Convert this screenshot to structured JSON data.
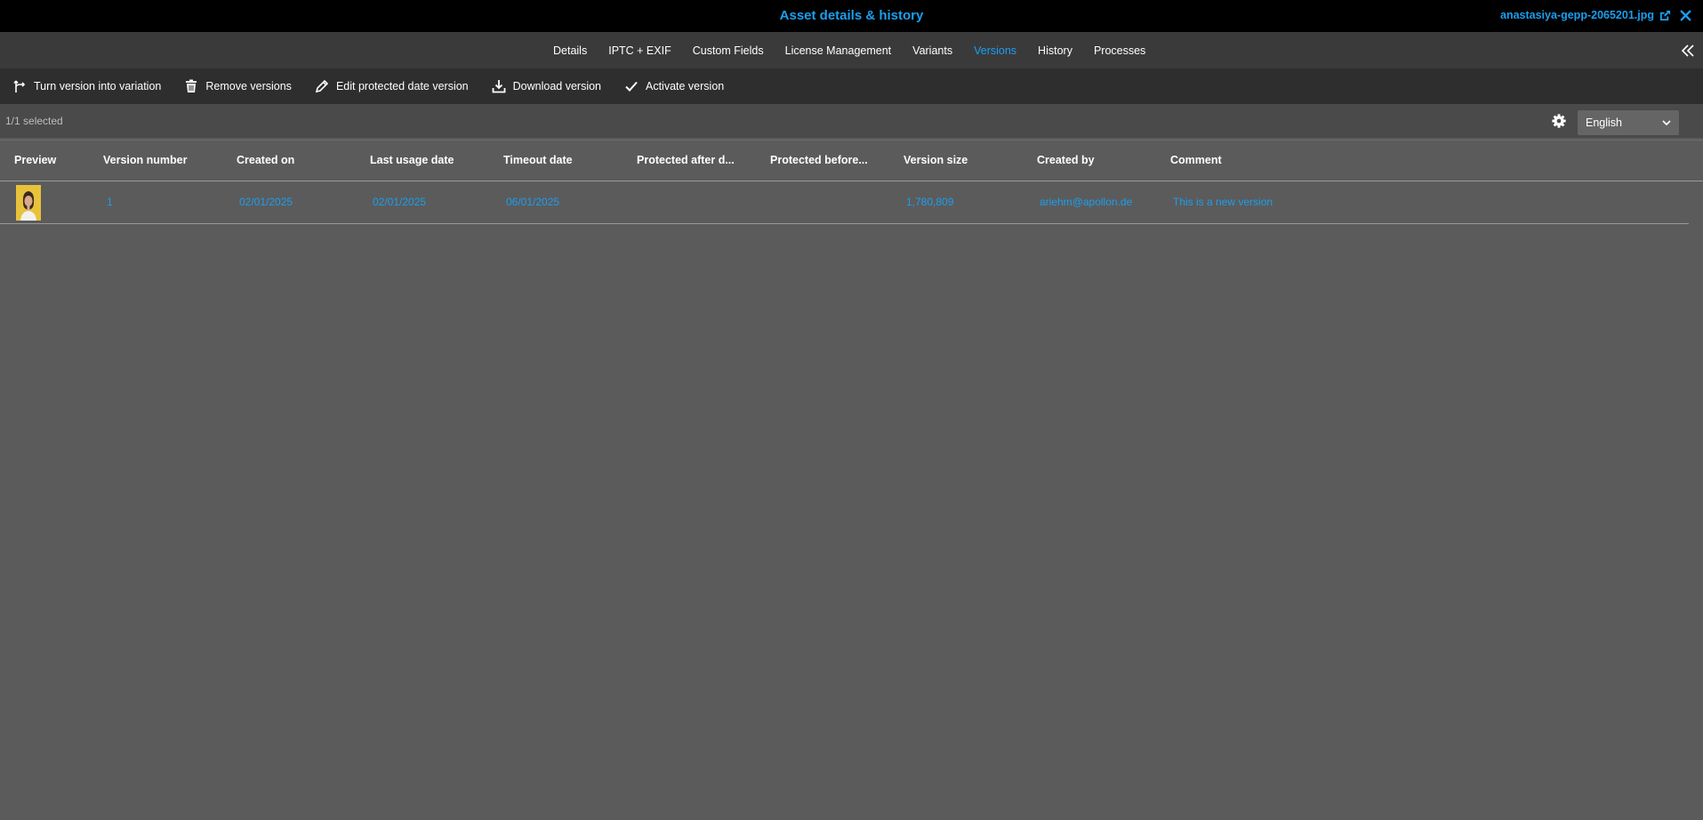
{
  "window": {
    "title": "Asset details & history",
    "filename": "anastasiya-gepp-2065201.jpg",
    "icons": [
      "external-link-icon",
      "close-icon"
    ]
  },
  "tabs": [
    {
      "label": "Details",
      "active": false
    },
    {
      "label": "IPTC + EXIF",
      "active": false
    },
    {
      "label": "Custom Fields",
      "active": false
    },
    {
      "label": "License Management",
      "active": false
    },
    {
      "label": "Variants",
      "active": false
    },
    {
      "label": "Versions",
      "active": true
    },
    {
      "label": "History",
      "active": false
    },
    {
      "label": "Processes",
      "active": false
    }
  ],
  "toolbar": {
    "actions": [
      {
        "label": "Turn version into variation",
        "icon": "branch-icon"
      },
      {
        "label": "Remove versions",
        "icon": "trash-icon"
      },
      {
        "label": "Edit protected date version",
        "icon": "pencil-icon"
      },
      {
        "label": "Download version",
        "icon": "download-icon"
      },
      {
        "label": "Activate version",
        "icon": "check-icon"
      }
    ]
  },
  "status": {
    "selected": "1/1 selected",
    "language": "English"
  },
  "table": {
    "columns": [
      "Preview",
      "Version number",
      "Created on",
      "Last usage date",
      "Timeout date",
      "Protected after d...",
      "Protected before...",
      "Version size",
      "Created by",
      "Comment"
    ],
    "rows": [
      {
        "version_number": "1",
        "created_on": "02/01/2025",
        "last_usage_date": "02/01/2025",
        "timeout_date": "06/01/2025",
        "protected_after": "",
        "protected_before": "",
        "version_size": "1,780,809",
        "created_by": "ariehm@apollon.de",
        "comment": "This is a new version"
      }
    ]
  },
  "colors": {
    "accent": "#1a9ff0",
    "background": "#5b5b5b",
    "titlebar": "#000000",
    "tabsbar": "#3a3a3a",
    "toolbar": "#2e2e2e"
  }
}
